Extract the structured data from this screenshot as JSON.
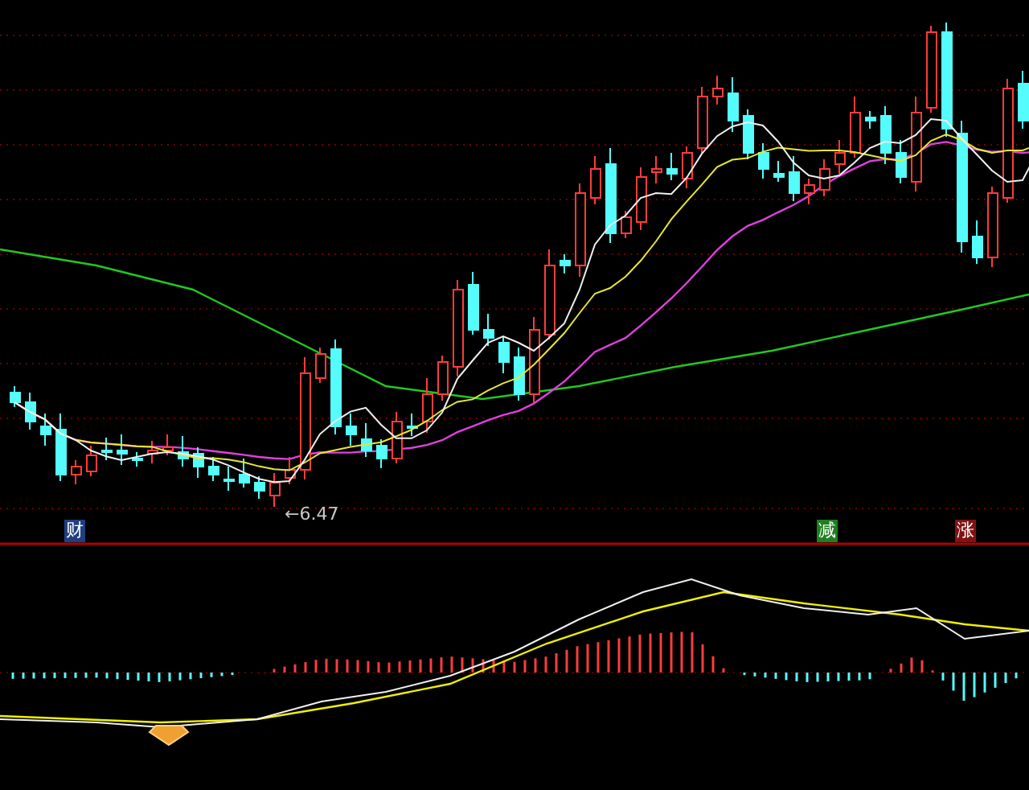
{
  "chart": {
    "price_label": "←6.47",
    "markers": [
      {
        "label": "财",
        "color": "#1f3f7f"
      },
      {
        "label": "减",
        "color": "#1f7f1f"
      },
      {
        "label": "涨",
        "color": "#7f1313"
      }
    ]
  }
}
